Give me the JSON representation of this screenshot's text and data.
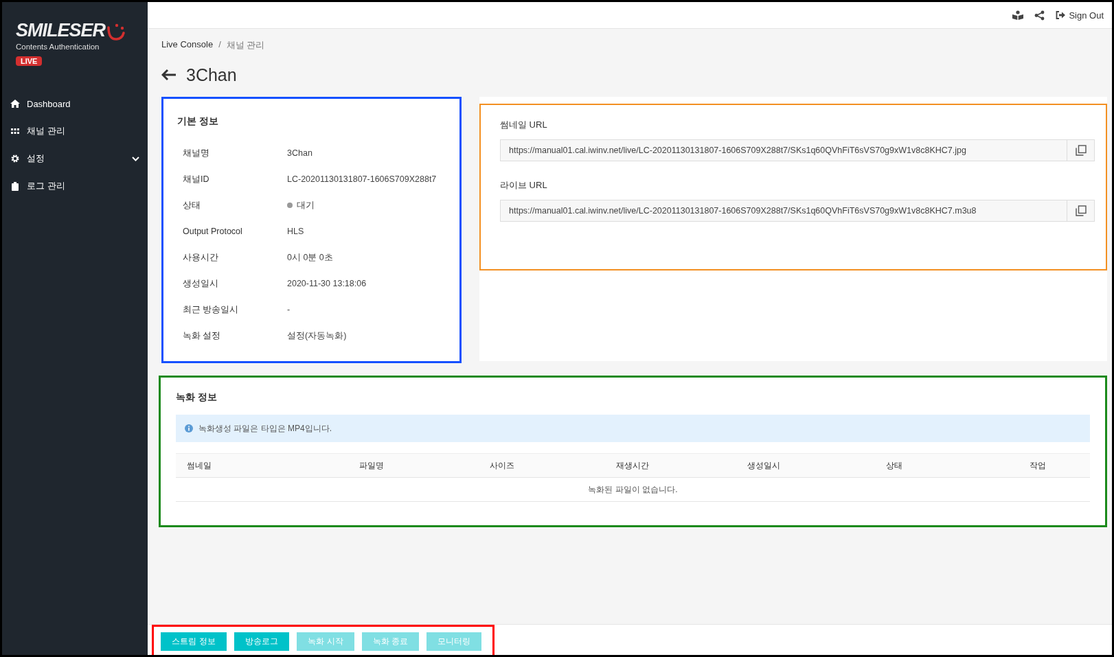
{
  "sidebar": {
    "logo": "SMILESER",
    "subtitle": "Contents Authentication",
    "badge": "LIVE",
    "items": [
      {
        "kind": "home",
        "label": "Dashboard",
        "expandable": false
      },
      {
        "kind": "grid",
        "label": "채널 관리",
        "expandable": false
      },
      {
        "kind": "gear",
        "label": "설정",
        "expandable": true
      },
      {
        "kind": "clipboard",
        "label": "로그 관리",
        "expandable": false
      }
    ]
  },
  "topbar": {
    "sign_out": "Sign Out"
  },
  "breadcrumb": {
    "parent": "Live Console",
    "separator": "/",
    "current": "채널 관리"
  },
  "page_title": "3Chan",
  "basic_info": {
    "title": "기본 정보",
    "rows": [
      {
        "label": "채널명",
        "value": "3Chan",
        "kind": "text"
      },
      {
        "label": "채널ID",
        "value": "LC-20201130131807-1606S709X288t7",
        "kind": "text"
      },
      {
        "label": "상태",
        "value": "대기",
        "kind": "status"
      },
      {
        "label": "Output Protocol",
        "value": "HLS",
        "kind": "text"
      },
      {
        "label": "사용시간",
        "value": "0시 0분 0초",
        "kind": "text"
      },
      {
        "label": "생성일시",
        "value": "2020-11-30 13:18:06",
        "kind": "text"
      },
      {
        "label": "최근 방송일시",
        "value": "-",
        "kind": "text"
      },
      {
        "label": "녹화 설정",
        "value": "설정(자동녹화)",
        "kind": "text"
      }
    ]
  },
  "urls": [
    {
      "label": "썸네일 URL",
      "value": "https://manual01.cal.iwinv.net/live/LC-20201130131807-1606S709X288t7/SKs1q60QVhFiT6sVS70g9xW1v8c8KHC7.jpg"
    },
    {
      "label": "라이브 URL",
      "value": "https://manual01.cal.iwinv.net/live/LC-20201130131807-1606S709X288t7/SKs1q60QVhFiT6sVS70g9xW1v8c8KHC7.m3u8"
    }
  ],
  "recording": {
    "title": "녹화 정보",
    "notice": "녹화생성 파일은 타입은 MP4입니다.",
    "columns": [
      "썸네일",
      "파일명",
      "사이즈",
      "재생시간",
      "생성일시",
      "상태",
      "작업"
    ],
    "empty_message": "녹화된 파일이 없습니다."
  },
  "buttons": [
    {
      "label": "스트림 정보",
      "disabled": false
    },
    {
      "label": "방송로그",
      "disabled": false
    },
    {
      "label": "녹화 시작",
      "disabled": true
    },
    {
      "label": "녹화 종료",
      "disabled": true
    },
    {
      "label": "모니터링",
      "disabled": true
    }
  ]
}
